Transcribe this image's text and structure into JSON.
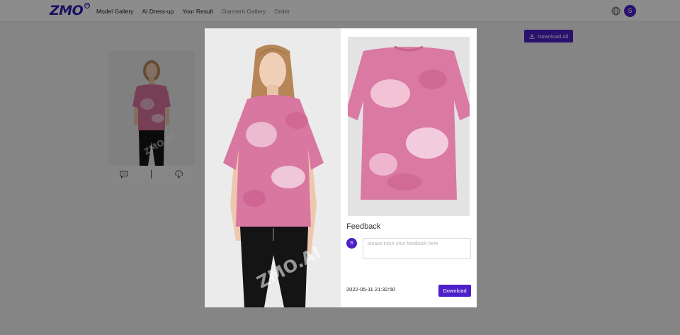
{
  "brand": {
    "logo_text": "ZMO",
    "logo_mark": "R",
    "accent": "#4b1fc9"
  },
  "nav": {
    "items": [
      {
        "label": "Model Gallery",
        "active": false
      },
      {
        "label": "AI Dress-up",
        "active": false
      },
      {
        "label": "Your Result",
        "active": true
      },
      {
        "label": "Garment Gallery",
        "active": false
      },
      {
        "label": "Order",
        "active": false
      }
    ]
  },
  "header_right": {
    "globe_icon": "globe-icon",
    "avatar_initial": "S"
  },
  "page": {
    "download_all_label": "Download All"
  },
  "result_card": {
    "watermark": "ZMO.AI",
    "feedback_icon": "comment-icon",
    "download_icon": "cloud-download-icon"
  },
  "modal": {
    "model_watermark": "ZMO.AI",
    "feedback_title": "Feedback",
    "feedback_avatar": "S",
    "feedback_placeholder": "please input your feedback here",
    "feedback_value": "",
    "timestamp": "2022-05-11 21:32:50",
    "download_label": "Download"
  }
}
